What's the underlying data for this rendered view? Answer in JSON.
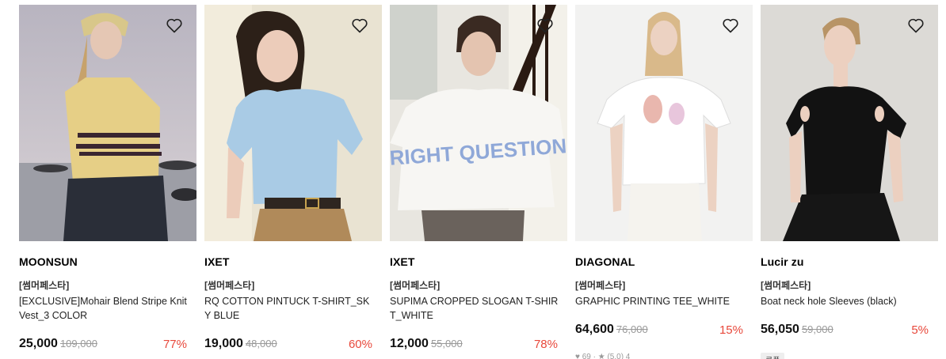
{
  "products": [
    {
      "brand": "MOONSUN",
      "promo": "[썸머페스타]",
      "name": "[EXCLUSIVE]Mohair Blend Stripe Knit Vest_3 COLOR",
      "price": "25,000",
      "original_price": "109,000",
      "discount": "77%",
      "wishlist_icon": "heart-outline-icon"
    },
    {
      "brand": "IXET",
      "promo": "[썸머페스타]",
      "name": "RQ COTTON PINTUCK T-SHIRT_SKY BLUE",
      "price": "19,000",
      "original_price": "48,000",
      "discount": "60%",
      "wishlist_icon": "heart-outline-icon"
    },
    {
      "brand": "IXET",
      "promo": "[썸머페스타]",
      "name": "SUPIMA CROPPED SLOGAN T-SHIRT_WHITE",
      "price": "12,000",
      "original_price": "55,000",
      "discount": "78%",
      "wishlist_icon": "heart-outline-icon"
    },
    {
      "brand": "DIAGONAL",
      "promo": "[썸머페스타]",
      "name": "GRAPHIC PRINTING TEE_WHITE",
      "price": "64,600",
      "original_price": "76,000",
      "discount": "15%",
      "meta": "♥ 69 · ★ (5.0) 4",
      "wishlist_icon": "heart-outline-icon"
    },
    {
      "brand": "Lucir zu",
      "promo": "[썸머페스타]",
      "name": "Boat neck hole Sleeves (black)",
      "price": "56,050",
      "original_price": "59,000",
      "discount": "5%",
      "coupon": "쿠폰",
      "wishlist_icon": "heart-outline-icon"
    }
  ],
  "colors": {
    "discount": "#e8483b",
    "original_price": "#999999",
    "text": "#111111"
  }
}
